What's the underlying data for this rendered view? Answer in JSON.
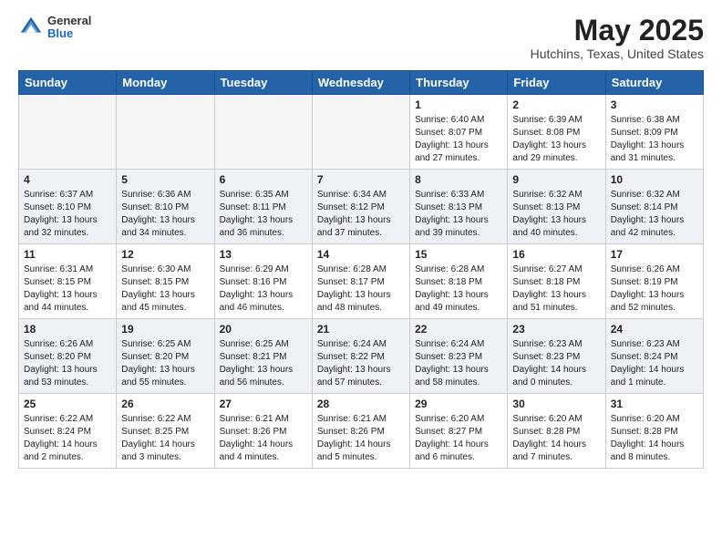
{
  "header": {
    "logo": {
      "general": "General",
      "blue": "Blue"
    },
    "title": "May 2025",
    "location": "Hutchins, Texas, United States"
  },
  "days_of_week": [
    "Sunday",
    "Monday",
    "Tuesday",
    "Wednesday",
    "Thursday",
    "Friday",
    "Saturday"
  ],
  "weeks": [
    {
      "alt": false,
      "days": [
        {
          "num": "",
          "info": "",
          "empty": true
        },
        {
          "num": "",
          "info": "",
          "empty": true
        },
        {
          "num": "",
          "info": "",
          "empty": true
        },
        {
          "num": "",
          "info": "",
          "empty": true
        },
        {
          "num": "1",
          "info": "Sunrise: 6:40 AM\nSunset: 8:07 PM\nDaylight: 13 hours\nand 27 minutes.",
          "empty": false
        },
        {
          "num": "2",
          "info": "Sunrise: 6:39 AM\nSunset: 8:08 PM\nDaylight: 13 hours\nand 29 minutes.",
          "empty": false
        },
        {
          "num": "3",
          "info": "Sunrise: 6:38 AM\nSunset: 8:09 PM\nDaylight: 13 hours\nand 31 minutes.",
          "empty": false
        }
      ]
    },
    {
      "alt": true,
      "days": [
        {
          "num": "4",
          "info": "Sunrise: 6:37 AM\nSunset: 8:10 PM\nDaylight: 13 hours\nand 32 minutes.",
          "empty": false
        },
        {
          "num": "5",
          "info": "Sunrise: 6:36 AM\nSunset: 8:10 PM\nDaylight: 13 hours\nand 34 minutes.",
          "empty": false
        },
        {
          "num": "6",
          "info": "Sunrise: 6:35 AM\nSunset: 8:11 PM\nDaylight: 13 hours\nand 36 minutes.",
          "empty": false
        },
        {
          "num": "7",
          "info": "Sunrise: 6:34 AM\nSunset: 8:12 PM\nDaylight: 13 hours\nand 37 minutes.",
          "empty": false
        },
        {
          "num": "8",
          "info": "Sunrise: 6:33 AM\nSunset: 8:13 PM\nDaylight: 13 hours\nand 39 minutes.",
          "empty": false
        },
        {
          "num": "9",
          "info": "Sunrise: 6:32 AM\nSunset: 8:13 PM\nDaylight: 13 hours\nand 40 minutes.",
          "empty": false
        },
        {
          "num": "10",
          "info": "Sunrise: 6:32 AM\nSunset: 8:14 PM\nDaylight: 13 hours\nand 42 minutes.",
          "empty": false
        }
      ]
    },
    {
      "alt": false,
      "days": [
        {
          "num": "11",
          "info": "Sunrise: 6:31 AM\nSunset: 8:15 PM\nDaylight: 13 hours\nand 44 minutes.",
          "empty": false
        },
        {
          "num": "12",
          "info": "Sunrise: 6:30 AM\nSunset: 8:15 PM\nDaylight: 13 hours\nand 45 minutes.",
          "empty": false
        },
        {
          "num": "13",
          "info": "Sunrise: 6:29 AM\nSunset: 8:16 PM\nDaylight: 13 hours\nand 46 minutes.",
          "empty": false
        },
        {
          "num": "14",
          "info": "Sunrise: 6:28 AM\nSunset: 8:17 PM\nDaylight: 13 hours\nand 48 minutes.",
          "empty": false
        },
        {
          "num": "15",
          "info": "Sunrise: 6:28 AM\nSunset: 8:18 PM\nDaylight: 13 hours\nand 49 minutes.",
          "empty": false
        },
        {
          "num": "16",
          "info": "Sunrise: 6:27 AM\nSunset: 8:18 PM\nDaylight: 13 hours\nand 51 minutes.",
          "empty": false
        },
        {
          "num": "17",
          "info": "Sunrise: 6:26 AM\nSunset: 8:19 PM\nDaylight: 13 hours\nand 52 minutes.",
          "empty": false
        }
      ]
    },
    {
      "alt": true,
      "days": [
        {
          "num": "18",
          "info": "Sunrise: 6:26 AM\nSunset: 8:20 PM\nDaylight: 13 hours\nand 53 minutes.",
          "empty": false
        },
        {
          "num": "19",
          "info": "Sunrise: 6:25 AM\nSunset: 8:20 PM\nDaylight: 13 hours\nand 55 minutes.",
          "empty": false
        },
        {
          "num": "20",
          "info": "Sunrise: 6:25 AM\nSunset: 8:21 PM\nDaylight: 13 hours\nand 56 minutes.",
          "empty": false
        },
        {
          "num": "21",
          "info": "Sunrise: 6:24 AM\nSunset: 8:22 PM\nDaylight: 13 hours\nand 57 minutes.",
          "empty": false
        },
        {
          "num": "22",
          "info": "Sunrise: 6:24 AM\nSunset: 8:23 PM\nDaylight: 13 hours\nand 58 minutes.",
          "empty": false
        },
        {
          "num": "23",
          "info": "Sunrise: 6:23 AM\nSunset: 8:23 PM\nDaylight: 14 hours\nand 0 minutes.",
          "empty": false
        },
        {
          "num": "24",
          "info": "Sunrise: 6:23 AM\nSunset: 8:24 PM\nDaylight: 14 hours\nand 1 minute.",
          "empty": false
        }
      ]
    },
    {
      "alt": false,
      "days": [
        {
          "num": "25",
          "info": "Sunrise: 6:22 AM\nSunset: 8:24 PM\nDaylight: 14 hours\nand 2 minutes.",
          "empty": false
        },
        {
          "num": "26",
          "info": "Sunrise: 6:22 AM\nSunset: 8:25 PM\nDaylight: 14 hours\nand 3 minutes.",
          "empty": false
        },
        {
          "num": "27",
          "info": "Sunrise: 6:21 AM\nSunset: 8:26 PM\nDaylight: 14 hours\nand 4 minutes.",
          "empty": false
        },
        {
          "num": "28",
          "info": "Sunrise: 6:21 AM\nSunset: 8:26 PM\nDaylight: 14 hours\nand 5 minutes.",
          "empty": false
        },
        {
          "num": "29",
          "info": "Sunrise: 6:20 AM\nSunset: 8:27 PM\nDaylight: 14 hours\nand 6 minutes.",
          "empty": false
        },
        {
          "num": "30",
          "info": "Sunrise: 6:20 AM\nSunset: 8:28 PM\nDaylight: 14 hours\nand 7 minutes.",
          "empty": false
        },
        {
          "num": "31",
          "info": "Sunrise: 6:20 AM\nSunset: 8:28 PM\nDaylight: 14 hours\nand 8 minutes.",
          "empty": false
        }
      ]
    }
  ]
}
